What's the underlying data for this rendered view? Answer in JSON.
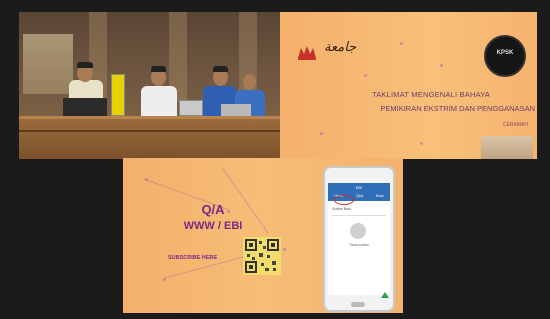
{
  "tiles": {
    "video": {
      "label": "Panel speakers video feed"
    },
    "slide": {
      "calligraphy": "جامعة",
      "logo_text": "KPSK",
      "title_line1": "TAKLIMAT MENGENALI BAHAYA",
      "title_line2": "PEMIKIRAN EKSTRIM DAN PENGGANASAN",
      "subtext": "CERAMAH"
    },
    "qa": {
      "title": "Q/A",
      "subtitle": "WWW / EBI",
      "subscribe_label": "SUBSCRIBE HERE",
      "phone": {
        "app_title": "EBI",
        "tabs": [
          "Home",
          "Q&A",
          "More"
        ],
        "row_label": "Soalan Baru",
        "message": "Tiada soalan"
      }
    }
  },
  "colors": {
    "background": "#1b1b1b",
    "accent": "#7a2a86",
    "slide_bg": "#f7bd77"
  }
}
